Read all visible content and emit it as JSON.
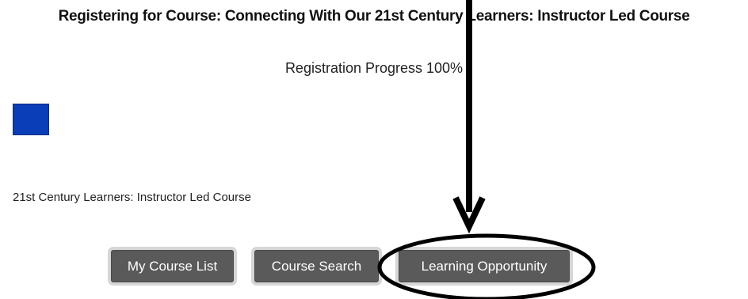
{
  "page": {
    "title": "Registering for Course: Connecting With Our 21st Century Learners: Instructor Led Course",
    "progress_text": "Registration Progress 100%",
    "progress_value": 1.0,
    "progress_color": "#0a3db8",
    "course_name": "21st Century Learners: Instructor Led Course"
  },
  "buttons": {
    "my_course_list": "My Course List",
    "course_search": "Course Search",
    "learning_opportunity": "Learning Opportunity"
  },
  "annotation": {
    "arrow_icon": "down-arrow-icon",
    "ellipse_icon": "highlight-ellipse-icon"
  }
}
